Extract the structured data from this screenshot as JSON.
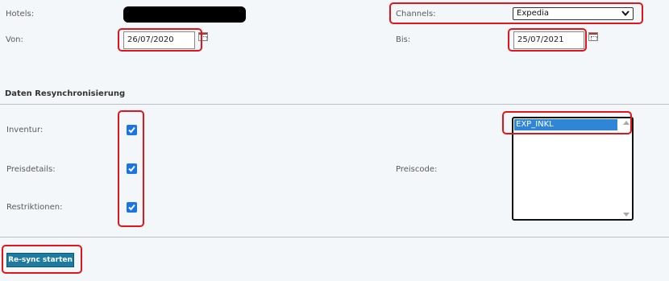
{
  "form": {
    "hotels_label": "Hotels:",
    "channels_label": "Channels:",
    "channel_selected": "Expedia",
    "von_label": "Von:",
    "von_value": "26/07/2020",
    "bis_label": "Bis:",
    "bis_value": "25/07/2021"
  },
  "resync": {
    "section_title": "Daten Resynchronisierung",
    "inventur_label": "Inventur:",
    "preisdetails_label": "Preisdetails:",
    "restriktionen_label": "Restriktionen:",
    "preiscode_label": "Preiscode:",
    "preiscode_options": [
      "EXP_INKL"
    ],
    "start_button": "Re-sync starten"
  },
  "colors": {
    "highlight": "#e2141c",
    "checkbox": "#1a73e8",
    "button": "#1d7aa0",
    "selected_option": "#2f86d6"
  }
}
